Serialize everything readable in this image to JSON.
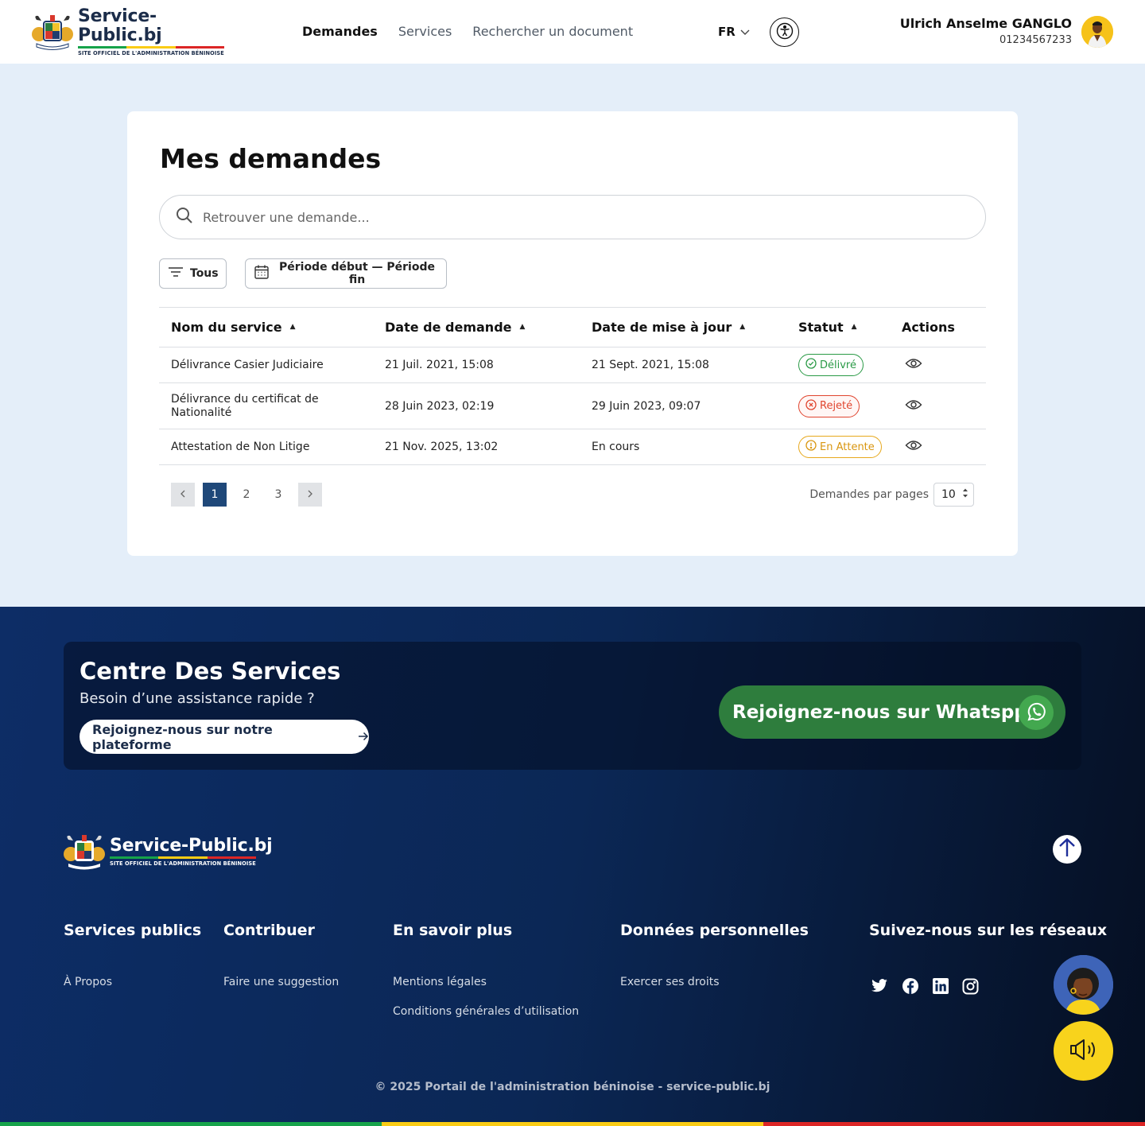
{
  "brand": {
    "title": "Service-Public.bj",
    "subtitle": "SITE OFFICIEL DE L'ADMINISTRATION BÉNINOISE",
    "flag_colors": [
      "#16a34a",
      "#facc15",
      "#dc2626"
    ]
  },
  "nav": {
    "items": [
      {
        "label": "Demandes",
        "active": true
      },
      {
        "label": "Services",
        "active": false
      },
      {
        "label": "Rechercher un document",
        "active": false
      }
    ],
    "language": "FR"
  },
  "user": {
    "name": "Ulrich Anselme GANGLO",
    "phone": "01234567233"
  },
  "page": {
    "title": "Mes demandes",
    "search_placeholder": "Retrouver une demande...",
    "filter_label": "Tous",
    "period_label": "Période début — Période fin"
  },
  "table": {
    "columns": [
      "Nom du service",
      "Date de demande",
      "Date de mise à jour",
      "Statut",
      "Actions"
    ],
    "rows": [
      {
        "service": "Délivrance Casier Judiciaire",
        "requested": "21 Juil. 2021, 15:08",
        "updated": "21 Sept. 2021, 15:08",
        "status": "Délivré",
        "status_kind": "success"
      },
      {
        "service": "Délivrance du certificat de Nationalité",
        "requested": "28 Juin 2023, 02:19",
        "updated": "29 Juin 2023, 09:07",
        "status": "Rejeté",
        "status_kind": "error"
      },
      {
        "service": "Attestation de Non Litige",
        "requested": "21 Nov. 2025, 13:02",
        "updated": "En cours",
        "status": "En Attente",
        "status_kind": "warning"
      }
    ]
  },
  "pagination": {
    "pages": [
      "1",
      "2",
      "3"
    ],
    "current": "1",
    "per_page_label": "Demandes par pages",
    "per_page_value": "10"
  },
  "footer": {
    "cds_title": "Centre Des Services",
    "cds_subtitle": "Besoin d’une assistance rapide ?",
    "platform_button": "Rejoignez-nous sur notre plateforme",
    "whatsapp_button": "Rejoignez-nous sur Whatspp",
    "columns": [
      {
        "heading": "Services publics",
        "links": [
          "À Propos"
        ]
      },
      {
        "heading": "Contribuer",
        "links": [
          "Faire une suggestion"
        ]
      },
      {
        "heading": "En savoir plus",
        "links": [
          "Mentions légales",
          "Conditions générales d’utilisation"
        ]
      },
      {
        "heading": "Données personnelles",
        "links": [
          "Exercer ses droits"
        ]
      },
      {
        "heading": "Suivez-nous sur les réseaux",
        "links": []
      }
    ],
    "social_icons": [
      "twitter-icon",
      "facebook-icon",
      "linkedin-icon",
      "instagram-icon"
    ],
    "copyright": "© 2025 Portail de l'administration béninoise - service-public.bj"
  },
  "colors": {
    "primary_navy": "#1f4879",
    "page_bg": "#e4eef9",
    "whatsapp_green": "#2e7d3d",
    "success": "#2a9a46",
    "error": "#e0452f",
    "warning": "#e7a81c",
    "speaker_yellow": "#f8d31c"
  }
}
